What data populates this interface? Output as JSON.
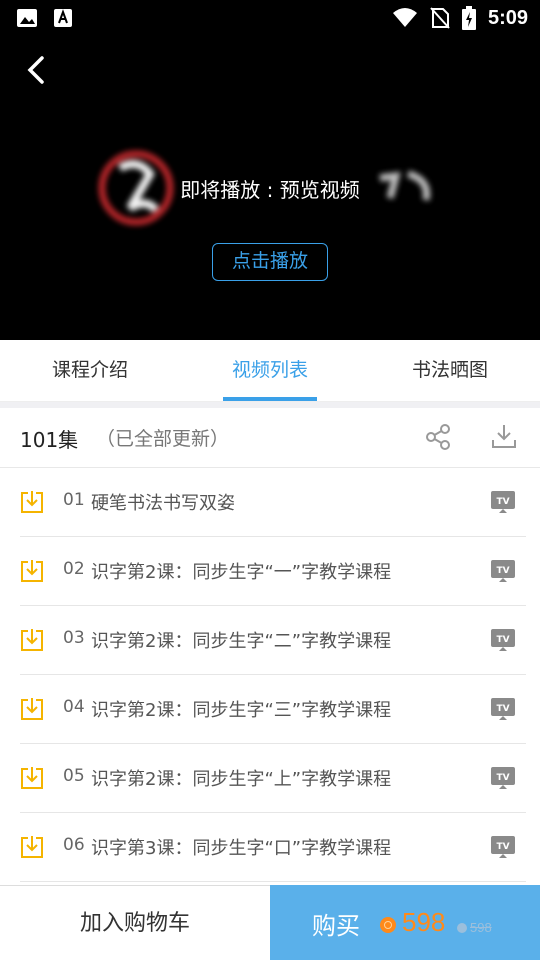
{
  "status_bar": {
    "time": "5:09",
    "left_icons": [
      "image-icon",
      "text-a-icon"
    ],
    "right_icons": [
      "wifi-icon",
      "no-sim-icon",
      "battery-charging-icon"
    ]
  },
  "video": {
    "preview_text": "即将播放 : 预览视频",
    "play_button_label": "点击播放"
  },
  "tabs": [
    {
      "label": "课程介绍",
      "active": false
    },
    {
      "label": "视频列表",
      "active": true
    },
    {
      "label": "书法晒图",
      "active": false
    }
  ],
  "summary": {
    "episode_count": "101集",
    "update_status": "（已全部更新）"
  },
  "episodes": [
    {
      "number": "01",
      "title": "硬笔书法书写双姿"
    },
    {
      "number": "02",
      "title": "识字第2课：同步生字“一”字教学课程"
    },
    {
      "number": "03",
      "title": "识字第2课：同步生字“二”字教学课程"
    },
    {
      "number": "04",
      "title": "识字第2课：同步生字“三”字教学课程"
    },
    {
      "number": "05",
      "title": "识字第2课：同步生字“上”字教学课程"
    },
    {
      "number": "06",
      "title": "识字第3课：同步生字“口”字教学课程"
    }
  ],
  "bottom_bar": {
    "cart_label": "加入购物车",
    "buy_label": "购买",
    "price": "598",
    "original_price": "598"
  },
  "colors": {
    "accent": "#3aa0e8",
    "buy_bg": "#5ab0ea",
    "price": "#ff8a1a",
    "download_icon": "#f5b400"
  }
}
